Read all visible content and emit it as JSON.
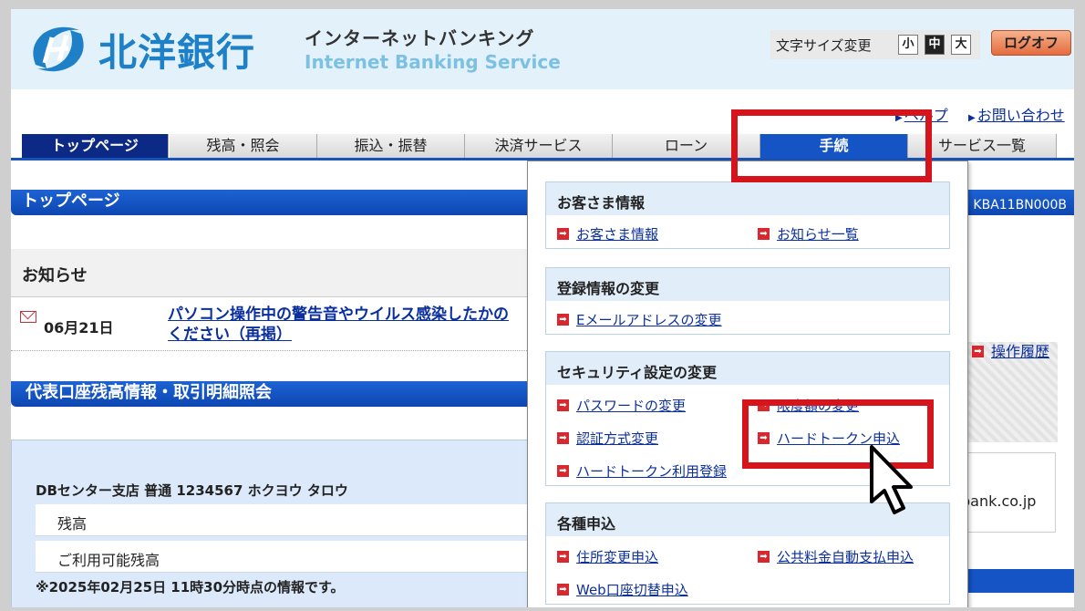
{
  "header": {
    "bank_name": "北洋銀行",
    "service_jp": "インターネットバンキング",
    "service_en": "Internet Banking Service",
    "font_size_label": "文字サイズ変更",
    "font_size_options": [
      "小",
      "中",
      "大"
    ],
    "font_size_selected": "中",
    "logoff_label": "ログオフ"
  },
  "top_links": {
    "help": "ヘルプ",
    "contact": "お問い合わせ"
  },
  "nav": {
    "tabs": [
      {
        "label": "トップページ"
      },
      {
        "label": "残高・照会"
      },
      {
        "label": "振込・振替"
      },
      {
        "label": "決済サービス"
      },
      {
        "label": "ローン"
      },
      {
        "label": "手続"
      },
      {
        "label": "サービス一覧"
      }
    ],
    "current": "トップページ",
    "open_menu": "手続"
  },
  "page": {
    "title": "トップページ",
    "screen_id": "KBA11BN000B"
  },
  "notices": {
    "title": "お知らせ",
    "items": [
      {
        "date": "06月21日",
        "text": "パソコン操作中の警告音やウイルス感染したかの",
        "text2": "ください（再掲）"
      }
    ]
  },
  "account": {
    "title": "代表口座残高情報・取引明細照会",
    "line": "DBセンター支店 普通 1234567 ホクヨウ タロウ",
    "balance_label": "残高",
    "available_label": "ご利用可能残高",
    "note": "※2025年02月25日 11時30分時点の情報です。"
  },
  "right": {
    "history_link": "操作履歴",
    "domain_text": "bank.co.jp"
  },
  "dropdown": {
    "groups": [
      {
        "title": "お客さま情報",
        "items": [
          {
            "label": "お客さま情報"
          },
          {
            "label": "お知らせ一覧"
          }
        ]
      },
      {
        "title": "登録情報の変更",
        "items": [
          {
            "label": "Eメールアドレスの変更"
          }
        ]
      },
      {
        "title": "セキュリティ設定の変更",
        "items": [
          {
            "label": "パスワードの変更"
          },
          {
            "label": "限度額の変更"
          },
          {
            "label": "認証方式変更"
          },
          {
            "label": "ハードトークン申込"
          },
          {
            "label": "ハードトークン利用登録"
          }
        ]
      },
      {
        "title": "各種申込",
        "items": [
          {
            "label": "住所変更申込"
          },
          {
            "label": "公共料金自動支払申込"
          },
          {
            "label": "Web口座切替申込"
          }
        ]
      }
    ]
  },
  "colors": {
    "brand_blue": "#1e80c6",
    "nav_active": "#1554c5",
    "highlight_red": "#d6141b"
  }
}
